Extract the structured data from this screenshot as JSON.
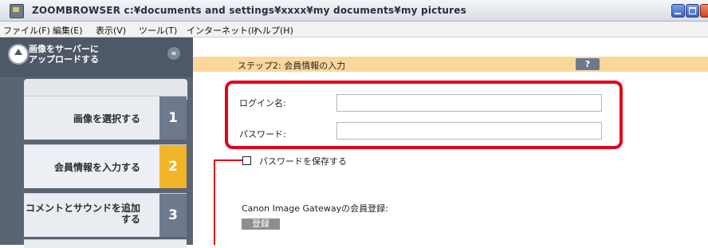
{
  "window": {
    "title": "ZOOMBROWSER c:¥documents and settings¥xxxx¥my documents¥my pictures"
  },
  "menu": [
    "ファイル(F)",
    "編集(E)",
    "表示(V)",
    "ツール(T)",
    "インターネット(I)",
    "ヘルプ(H)"
  ],
  "sidebar": {
    "title": "画像をサーバーに\nアップロードする",
    "collapse_glyph": "«",
    "steps": [
      {
        "label": "画像を選択する",
        "number": "1",
        "active": false
      },
      {
        "label": "会員情報を入力する",
        "number": "2",
        "active": true
      },
      {
        "label": "コメントとサウンドを追加する",
        "number": "3",
        "active": false
      }
    ]
  },
  "main": {
    "step_title": "ステップ2: 会員情報の入力",
    "help_label": "?",
    "login_label": "ログイン名:",
    "login_value": "",
    "password_label": "パスワード:",
    "password_value": "",
    "save_password_label": "パスワードを保存する",
    "save_password_checked": false,
    "registration_text": "Canon Image Gatewayの会員登録:",
    "register_button": "登録"
  },
  "colors": {
    "highlight_red": "#e2001a",
    "active_step": "#f2b428",
    "step_bar": "#fbd79b"
  }
}
